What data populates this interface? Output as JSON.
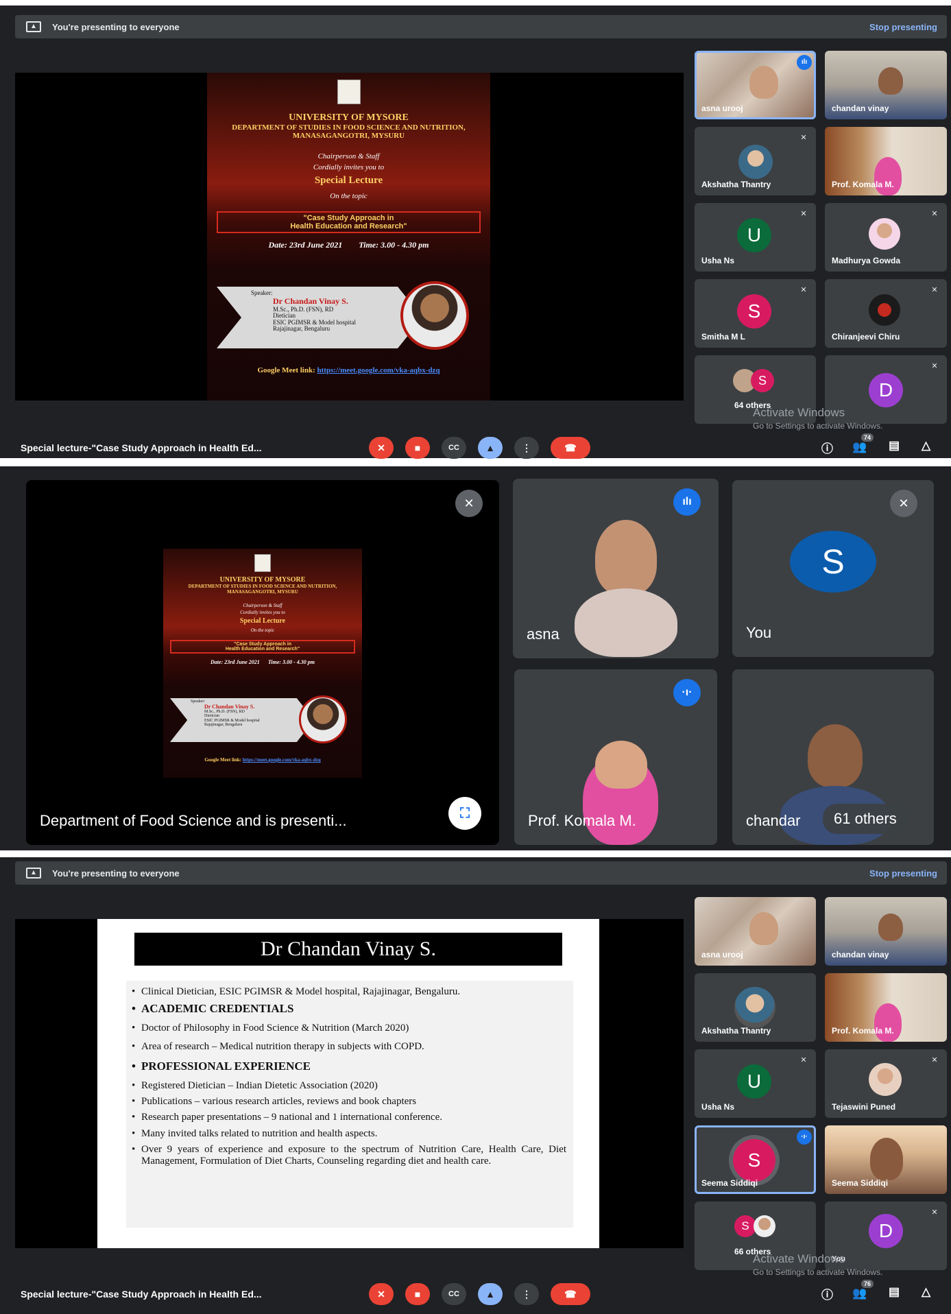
{
  "section1": {
    "banner": {
      "text": "You're presenting to everyone",
      "stop": "Stop presenting"
    },
    "poster": {
      "university": "UNIVERSITY OF MYSORE",
      "department": "DEPARTMENT OF STUDIES IN FOOD SCIENCE AND NUTRITION,",
      "place": "MANASAGANGOTRI, MYSURU",
      "invite1": "Chairperson & Staff",
      "invite2": "Cordially invites you to",
      "special": "Special Lecture",
      "ontopic": "On the topic",
      "topic1": "\"Case Study Approach in",
      "topic2": "Health Education and Research\"",
      "date": "Date: 23rd June 2021",
      "time": "Time: 3.00 - 4.30 pm",
      "speaker_label": "Speaker:",
      "speaker_name": "Dr Chandan Vinay S.",
      "speaker_l1": "M.Sc., Ph.D. (FSN), RD",
      "speaker_l2": "Dietician",
      "speaker_l3": "ESIC PGIMSR & Model hospital",
      "speaker_l4": "Rajajinagar, Bengaluru",
      "link_label": "Google Meet link:",
      "link": "https://meet.google.com/vka-aqbx-dzq"
    },
    "tiles": [
      {
        "name": "asna urooj"
      },
      {
        "name": "chandan vinay"
      },
      {
        "name": "Akshatha Thantry"
      },
      {
        "name": "Prof. Komala M."
      },
      {
        "name": "Usha Ns",
        "initial": "U"
      },
      {
        "name": "Madhurya Gowda"
      },
      {
        "name": "Smitha M L",
        "initial": "S"
      },
      {
        "name": "Chiranjeevi Chiru"
      },
      {
        "name": "64 others",
        "initial": "S"
      },
      {
        "name": "",
        "initial": "D"
      }
    ],
    "activate_title": "Activate Windows",
    "activate_sub": "Go to Settings to activate Windows.",
    "meeting_title": "Special lecture-\"Case Study Approach in Health Ed...",
    "people_count": "74"
  },
  "section2": {
    "presenter_label": "Department of Food Science and is presenti...",
    "tile_asna": "asna",
    "tile_you": "You",
    "tile_you_initial": "S",
    "tile_komala": "Prof. Komala M.",
    "tile_chandan": "chandar",
    "others": "61 others"
  },
  "section3": {
    "banner": {
      "text": "You're presenting to everyone",
      "stop": "Stop presenting"
    },
    "slide": {
      "title": "Dr Chandan Vinay S.",
      "items": [
        {
          "text": "Clinical Dietician, ESIC PGIMSR & Model hospital, Rajajinagar, Bengaluru."
        },
        {
          "text": "ACADEMIC CREDENTIALS"
        },
        {
          "text": "Doctor of Philosophy in Food Science & Nutrition (March 2020)"
        },
        {
          "text": "Area of research – Medical nutrition therapy in subjects with COPD."
        },
        {
          "text": "PROFESSIONAL EXPERIENCE"
        },
        {
          "text": "Registered Dietician – Indian Dietetic Association (2020)"
        },
        {
          "text": "Publications – various research articles, reviews and book chapters"
        },
        {
          "text": "Research paper presentations – 9 national and 1 international conference."
        },
        {
          "text": "Many  invited talks related to nutrition and health aspects."
        },
        {
          "text": "Over 9 years of experience and exposure to the spectrum of Nutrition Care, Health Care, Diet Management, Formulation of Diet Charts, Counseling regarding diet and health care."
        }
      ]
    },
    "tiles": [
      {
        "name": "asna urooj"
      },
      {
        "name": "chandan vinay"
      },
      {
        "name": "Akshatha Thantry"
      },
      {
        "name": "Prof. Komala M."
      },
      {
        "name": "Usha Ns",
        "initial": "U"
      },
      {
        "name": "Tejaswini Puned"
      },
      {
        "name": "Seema Siddiqi",
        "initial": "S"
      },
      {
        "name": "Seema Siddiqi"
      },
      {
        "name": "66 others",
        "initial": "S"
      },
      {
        "name": "You",
        "initial": "D"
      }
    ],
    "activate_title": "Activate Windows",
    "activate_sub": "Go to Settings to activate Windows.",
    "meeting_title": "Special lecture-\"Case Study Approach in Health Ed...",
    "people_count": "76"
  },
  "icons": {
    "mic_off": "mic-off-icon",
    "cam_off": "camera-off-icon",
    "cc": "captions-icon",
    "present": "present-icon",
    "more": "more-options-icon",
    "end": "end-call-icon",
    "info": "info-icon",
    "people": "people-icon",
    "chat": "chat-icon",
    "activities": "activities-icon"
  },
  "colors": {
    "meet_red": "#ea4335",
    "meet_blue": "#8ab4f8",
    "bg": "#202124",
    "tile": "#3c4043"
  }
}
